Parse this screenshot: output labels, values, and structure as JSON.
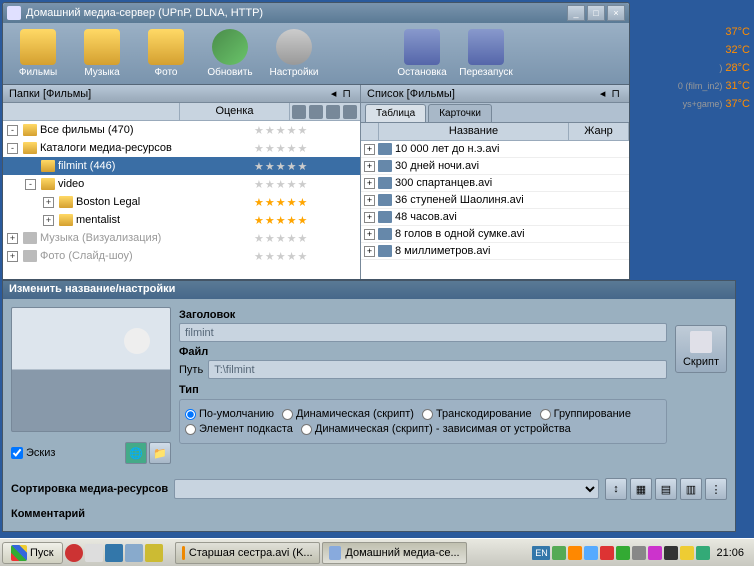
{
  "desktop_widgets": [
    {
      "label": "",
      "val": "37°C"
    },
    {
      "label": "",
      "val": "32°C"
    },
    {
      "label": ")",
      "val": "28°C"
    },
    {
      "label": "0 (film_in2)",
      "val": "31°C"
    },
    {
      "label": "ys+game)",
      "val": "37°C"
    }
  ],
  "window": {
    "title": "Домашний медиа-сервер (UPnP, DLNA, HTTP)"
  },
  "toolbar": [
    {
      "name": "films",
      "label": "Фильмы"
    },
    {
      "name": "music",
      "label": "Музыка"
    },
    {
      "name": "photo",
      "label": "Фото"
    },
    {
      "name": "refresh",
      "label": "Обновить"
    },
    {
      "name": "settings",
      "label": "Настройки"
    },
    {
      "name": "blank1",
      "label": ""
    },
    {
      "name": "stop",
      "label": "Остановка"
    },
    {
      "name": "restart",
      "label": "Перезапуск"
    }
  ],
  "left_panel": {
    "title": "Папки [Фильмы]",
    "rating_header": "Оценка"
  },
  "tree": [
    {
      "indent": 0,
      "exp": "-",
      "label": "Все фильмы (470)",
      "gray": false,
      "rating": 0,
      "sel": false
    },
    {
      "indent": 0,
      "exp": "-",
      "label": "Каталоги медиа-ресурсов",
      "gray": false,
      "rating": 0,
      "sel": false
    },
    {
      "indent": 1,
      "exp": "",
      "label": "filmint (446)",
      "gray": false,
      "rating": 0,
      "sel": true
    },
    {
      "indent": 1,
      "exp": "-",
      "label": "video",
      "gray": false,
      "rating": 0,
      "sel": false
    },
    {
      "indent": 2,
      "exp": "+",
      "label": "Boston Legal",
      "gray": false,
      "rating": 5,
      "sel": false
    },
    {
      "indent": 2,
      "exp": "+",
      "label": "mentalist",
      "gray": false,
      "rating": 5,
      "sel": false
    },
    {
      "indent": 0,
      "exp": "+",
      "label": "Музыка (Визуализация)",
      "gray": true,
      "rating": 0,
      "sel": false
    },
    {
      "indent": 0,
      "exp": "+",
      "label": "Фото (Слайд-шоу)",
      "gray": true,
      "rating": 0,
      "sel": false
    }
  ],
  "right_panel": {
    "title": "Список [Фильмы]",
    "tabs": [
      "Таблица",
      "Карточки"
    ],
    "columns": {
      "name": "Название",
      "genre": "Жанр"
    }
  },
  "list": [
    "10 000 лет до н.э.avi",
    "30 дней ночи.avi",
    "300 спартанцев.avi",
    "36 ступеней Шаолиня.avi",
    "48 часов.avi",
    "8 голов в одной сумке.avi",
    "8 миллиметров.avi"
  ],
  "dialog": {
    "title": "Изменить название/настройки",
    "header_label": "Заголовок",
    "header_value": "filmint",
    "file_label": "Файл",
    "path_label": "Путь",
    "path_value": "T:\\filmint",
    "type_label": "Тип",
    "radios_row1": [
      "По-умолчанию",
      "Динамическая (скрипт)",
      "Транскодирование",
      "Группирование"
    ],
    "radios_row2": [
      "Элемент подкаста",
      "Динамическая (скрипт) - зависимая от устройства"
    ],
    "script_btn": "Скрипт",
    "thumb_check": "Эскиз",
    "sort_label": "Сортировка медиа-ресурсов",
    "comments_label": "Комментарий"
  },
  "taskbar": {
    "start": "Пуск",
    "tasks": [
      {
        "label": "Старшая сестра.avi (K...",
        "active": false
      },
      {
        "label": "Домашний медиа-се...",
        "active": true
      }
    ],
    "lang": "EN",
    "clock": "21:06"
  }
}
